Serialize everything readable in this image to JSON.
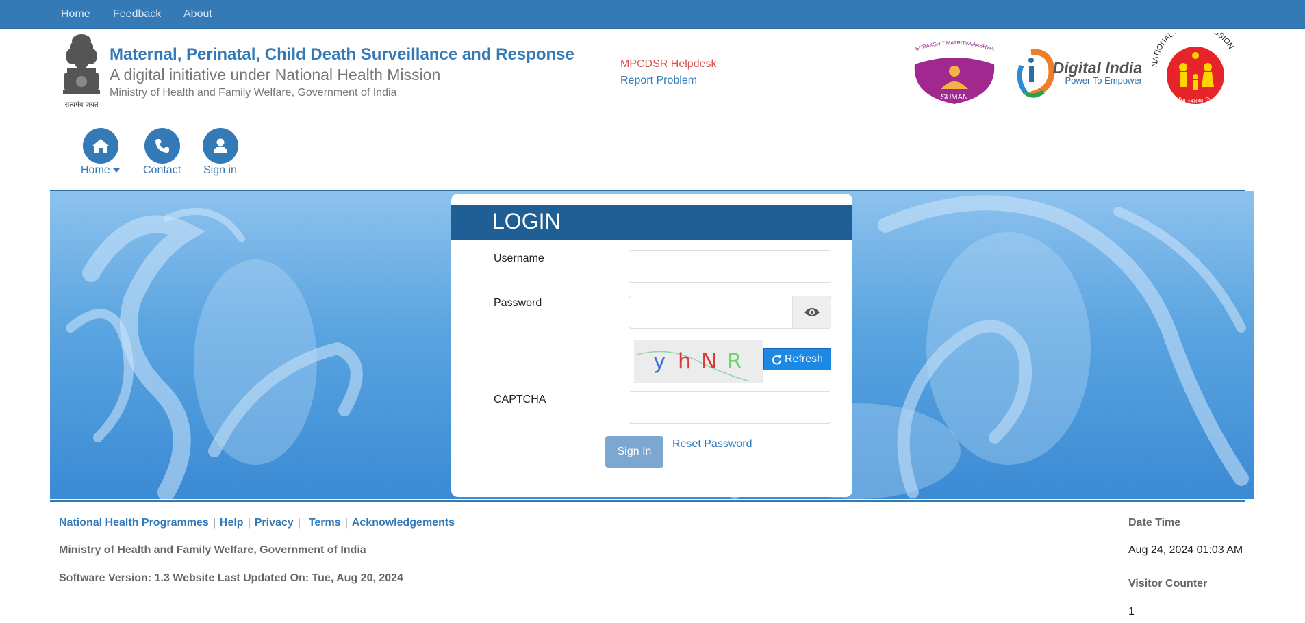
{
  "topnav": {
    "home": "Home",
    "feedback": "Feedback",
    "about": "About"
  },
  "header": {
    "emblem_caption": "सत्यमेव जयते",
    "title": "Maternal, Perinatal, Child Death Surveillance and Response",
    "subtitle": "A digital initiative under National Health Mission",
    "ministry": "Ministry of Health and Family Welfare, Government of India",
    "helpdesk": "MPCDSR Helpdesk",
    "report_problem": "Report Problem"
  },
  "logos": {
    "suman_top": "SURAKSHIT MATRITVA AASHWASAN",
    "suman_name": "SUMAN",
    "digital_india": "Digital India",
    "digital_india_tag": "Power To Empower",
    "nhm_ring": "NATIONAL HEALTH MISSION",
    "nhm_hindi": "राष्ट्रीय स्वास्थ्य मिशन"
  },
  "iconnav": {
    "home": "Home",
    "contact": "Contact",
    "signin": "Sign in"
  },
  "login": {
    "title": "LOGIN",
    "username_label": "Username",
    "password_label": "Password",
    "captcha_label": "CAPTCHA",
    "captcha_chars": [
      "y",
      "h",
      "N",
      "R"
    ],
    "refresh": "Refresh",
    "signin": "Sign In",
    "reset": "Reset Password"
  },
  "footer": {
    "links": [
      "National Health Programmes",
      "Help",
      "Privacy",
      "Terms",
      "Acknowledgements"
    ],
    "ministry": "Ministry of Health and Family Welfare, Government of India",
    "version": "Software Version: 1.3 Website Last Updated On: Tue, Aug 20, 2024",
    "datetime_label": "Date Time",
    "datetime_value": "Aug 24, 2024 01:03 AM",
    "visitor_label": "Visitor Counter",
    "visitor_value": "1"
  },
  "colors": {
    "primary": "#337ab7",
    "login_header": "#1f5f96",
    "helpdesk": "#d9534f",
    "refresh_button": "#1e88e5"
  }
}
